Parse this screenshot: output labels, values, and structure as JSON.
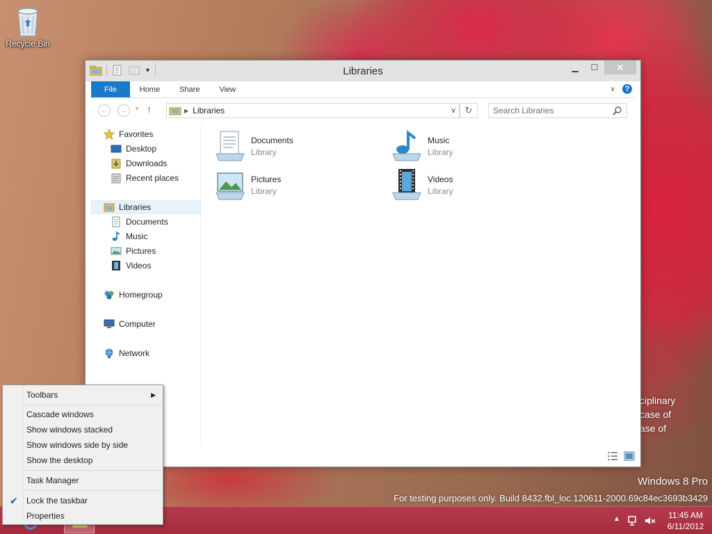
{
  "desktop": {
    "recycle_bin_label": "Recycle Bin",
    "behind_text_lines": [
      "ciplinary",
      "case of",
      "ase of"
    ],
    "watermark_edition": "Windows 8 Pro",
    "watermark_build": "For testing purposes only. Build 8432.fbl_loc.120611-2000.69c84ec3693b3429"
  },
  "window": {
    "title": "Libraries",
    "ribbon_tabs": [
      "File",
      "Home",
      "Share",
      "View"
    ],
    "help_label": "?",
    "address": {
      "crumb": "Libraries"
    },
    "search": {
      "placeholder": "Search Libraries"
    },
    "nav": {
      "favorites": "Favorites",
      "desktop": "Desktop",
      "downloads": "Downloads",
      "recent": "Recent places",
      "libraries": "Libraries",
      "documents": "Documents",
      "music": "Music",
      "pictures": "Pictures",
      "videos": "Videos",
      "homegroup": "Homegroup",
      "computer": "Computer",
      "network": "Network"
    },
    "libraries": [
      {
        "name": "Documents",
        "type": "Library",
        "icon": "documents-library-icon"
      },
      {
        "name": "Music",
        "type": "Library",
        "icon": "music-library-icon"
      },
      {
        "name": "Pictures",
        "type": "Library",
        "icon": "pictures-library-icon"
      },
      {
        "name": "Videos",
        "type": "Library",
        "icon": "videos-library-icon"
      }
    ]
  },
  "context_menu": {
    "toolbars": "Toolbars",
    "cascade": "Cascade windows",
    "stacked": "Show windows stacked",
    "side_by_side": "Show windows side by side",
    "show_desktop": "Show the desktop",
    "task_manager": "Task Manager",
    "lock_taskbar": "Lock the taskbar",
    "lock_taskbar_checked": true,
    "properties": "Properties"
  },
  "taskbar": {
    "time": "11:45 AM",
    "date": "6/11/2012"
  },
  "colors": {
    "accent": "#1979ca",
    "taskbar": "#a62b3f"
  }
}
